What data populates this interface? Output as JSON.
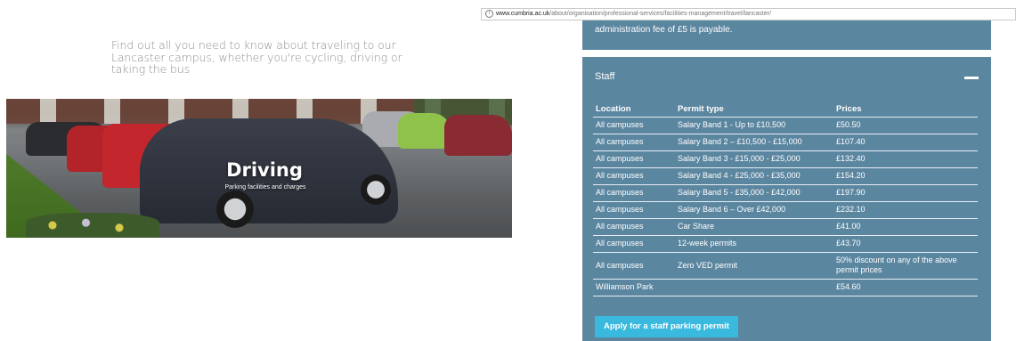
{
  "browser": {
    "url_domain": "www.cumbria.ac.uk",
    "url_path": "/about/organisation/professional-services/facilities-management/travel/lancaster/"
  },
  "intro": {
    "text": "Find out all you need to know about traveling to our Lancaster campus, whether you're cycling, driving or taking the bus"
  },
  "hero": {
    "title": "Driving",
    "subtitle": "Parking facilities and charges"
  },
  "previous_panel": {
    "text": "administration fee of £5 is payable."
  },
  "staff_panel": {
    "title": "Staff",
    "toggle_icon": "minus-icon",
    "headers": [
      "Location",
      "Permit type",
      "Prices"
    ],
    "rows": [
      {
        "location": "All campuses",
        "type": "Salary Band 1 - Up to £10,500",
        "price": "£50.50"
      },
      {
        "location": "All campuses",
        "type": "Salary Band 2 – £10,500 - £15,000",
        "price": "£107.40"
      },
      {
        "location": "All campuses",
        "type": "Salary Band 3 - £15,000 - £25,000",
        "price": "£132.40"
      },
      {
        "location": "All campuses",
        "type": "Salary Band 4 - £25,000 - £35,000",
        "price": "£154.20"
      },
      {
        "location": "All campuses",
        "type": "Salary Band 5 - £35,000 - £42,000",
        "price": "£197.90"
      },
      {
        "location": "All campuses",
        "type": "Salary Band 6 – Over £42,000",
        "price": "£232.10"
      },
      {
        "location": "All campuses",
        "type": "Car Share",
        "price": "£41.00"
      },
      {
        "location": "All campuses",
        "type": "12-week permits",
        "price": "£43.70"
      },
      {
        "location": "All campuses",
        "type": "Zero VED permit",
        "price": "50% discount on any of the above permit prices"
      },
      {
        "location": "Williamson Park",
        "type": "",
        "price": "£54.60"
      }
    ],
    "apply_label": "Apply for a staff parking permit"
  },
  "colors": {
    "panel": "#5b86a0",
    "button": "#3ab9de",
    "intro_text": "#8e8e8e"
  }
}
